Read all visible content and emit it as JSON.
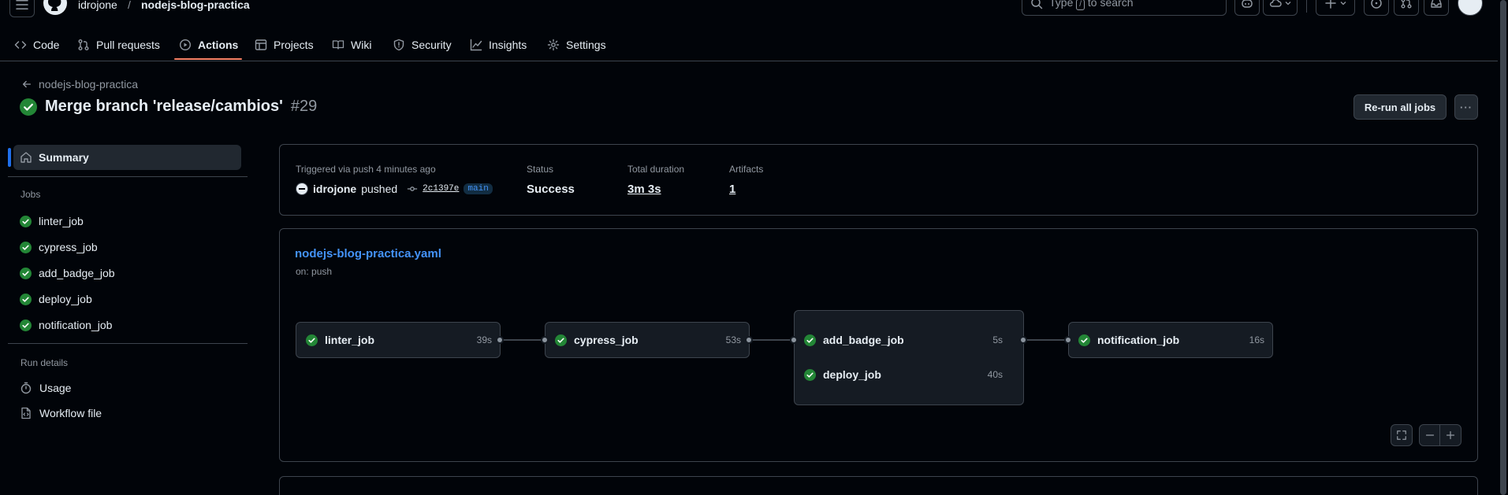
{
  "header": {
    "owner": "idrojone",
    "separator": "/",
    "repo": "nodejs-blog-practica",
    "search_prefix": "Type",
    "search_key": "/",
    "search_suffix": "to search"
  },
  "nav": {
    "code": "Code",
    "pulls": "Pull requests",
    "actions": "Actions",
    "projects": "Projects",
    "wiki": "Wiki",
    "security": "Security",
    "insights": "Insights",
    "settings": "Settings"
  },
  "run": {
    "back_label": "nodejs-blog-practica",
    "title": "Merge branch 'release/cambios'",
    "number": "#29",
    "rerun_label": "Re-run all jobs",
    "more_label": "···"
  },
  "sidebar": {
    "summary": "Summary",
    "jobs_heading": "Jobs",
    "jobs": [
      "linter_job",
      "cypress_job",
      "add_badge_job",
      "deploy_job",
      "notification_job"
    ],
    "run_details_heading": "Run details",
    "usage": "Usage",
    "workflow_file": "Workflow file"
  },
  "summary": {
    "trigger": "Triggered via push 4 minutes ago",
    "actor": "idrojone",
    "action": "pushed",
    "commit": "2c1397e",
    "branch": "main",
    "status_label": "Status",
    "status_value": "Success",
    "duration_label": "Total duration",
    "duration_value": "3m 3s",
    "artifacts_label": "Artifacts",
    "artifacts_value": "1"
  },
  "workflow": {
    "file": "nodejs-blog-practica.yaml",
    "trigger": "on: push",
    "jobs": [
      {
        "name": "linter_job",
        "duration": "39s"
      },
      {
        "name": "cypress_job",
        "duration": "53s"
      },
      {
        "name": "add_badge_job",
        "duration": "5s"
      },
      {
        "name": "deploy_job",
        "duration": "40s"
      },
      {
        "name": "notification_job",
        "duration": "16s"
      }
    ]
  },
  "colors": {
    "success": "#238636",
    "link": "#4493f8",
    "accent_underline": "#f78166"
  }
}
